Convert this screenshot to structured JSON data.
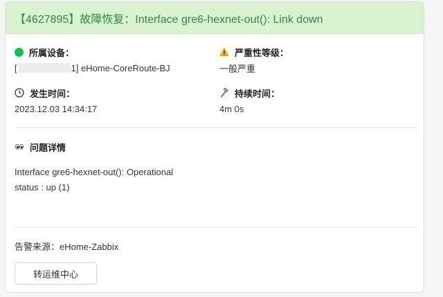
{
  "header": {
    "title": "【4627895】故障恢复：Interface gre6-hexnet-out(): Link down"
  },
  "device": {
    "label": "所属设备：",
    "value_prefix": "[",
    "value_suffix": "1] eHome-CoreRoute-BJ",
    "icon": "green-dot-icon"
  },
  "severity": {
    "label": "严重性等级：",
    "value": "一般严重",
    "icon": "warning-icon"
  },
  "occurred": {
    "label": "发生时间：",
    "value": "2023.12.03 14:34:17",
    "icon": "clock-icon"
  },
  "duration": {
    "label": "持续时间：",
    "value": "4m 0s",
    "icon": "hammer-icon"
  },
  "details": {
    "label": "问题详情",
    "icon": "eyes-icon",
    "lines": [
      "Interface gre6-hexnet-out(): Operational",
      "status : up (1)"
    ]
  },
  "source": {
    "text": "告警来源：eHome-Zabbix"
  },
  "actions": {
    "ops_center_label": "转运维中心"
  },
  "colors": {
    "header_bg": "#d9f2d2",
    "header_text": "#2f8a3c",
    "status_green": "#17c04a",
    "warning_yellow": "#f5b800"
  }
}
